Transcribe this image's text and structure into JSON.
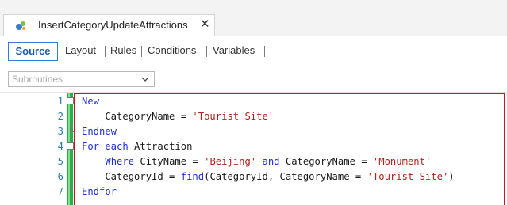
{
  "tab": {
    "title": "InsertCategoryUpdateAttractions",
    "close_glyph": "✕",
    "icon": "transaction-icon"
  },
  "view_tabs": [
    "Source",
    "Layout",
    "Rules",
    "Conditions",
    "Variables"
  ],
  "subroutines": {
    "value": "Subroutines"
  },
  "colors": {
    "keyword": "#1f2dd6",
    "string": "#b0231c",
    "line_number": "#2a7ab0",
    "highlight": "#c8161d",
    "gutter": "#26b14b",
    "active_tab": "#1b5fb0"
  },
  "code_lines": [
    {
      "n": "1",
      "parts": [
        {
          "t": "New",
          "c": "kw"
        }
      ]
    },
    {
      "n": "2",
      "parts": [
        {
          "t": "    CategoryName = ",
          "c": ""
        },
        {
          "t": "'Tourist Site'",
          "c": "str"
        }
      ]
    },
    {
      "n": "3",
      "parts": [
        {
          "t": "Endnew",
          "c": "kw"
        }
      ]
    },
    {
      "n": "4",
      "parts": [
        {
          "t": "For each",
          "c": "kw"
        },
        {
          "t": " Attraction",
          "c": ""
        }
      ]
    },
    {
      "n": "5",
      "parts": [
        {
          "t": "    ",
          "c": ""
        },
        {
          "t": "Where",
          "c": "kw"
        },
        {
          "t": " CityName = ",
          "c": ""
        },
        {
          "t": "'Beijing'",
          "c": "str"
        },
        {
          "t": " ",
          "c": ""
        },
        {
          "t": "and",
          "c": "kw"
        },
        {
          "t": " CategoryName = ",
          "c": ""
        },
        {
          "t": "'Monument'",
          "c": "str"
        }
      ]
    },
    {
      "n": "6",
      "parts": [
        {
          "t": "    CategoryId = ",
          "c": ""
        },
        {
          "t": "find",
          "c": "kw"
        },
        {
          "t": "(CategoryId, CategoryName = ",
          "c": ""
        },
        {
          "t": "'Tourist Site'",
          "c": "str"
        },
        {
          "t": ")",
          "c": ""
        }
      ]
    },
    {
      "n": "7",
      "parts": [
        {
          "t": "Endfor",
          "c": "kw"
        }
      ]
    }
  ]
}
